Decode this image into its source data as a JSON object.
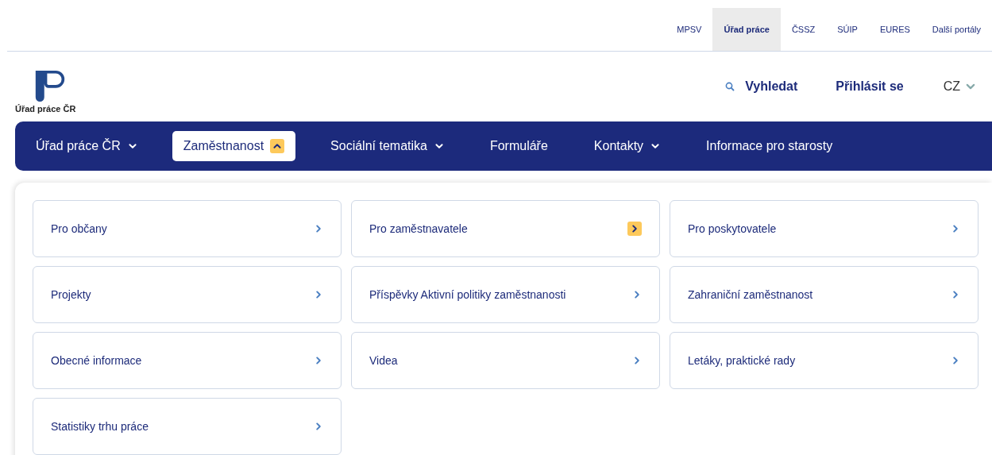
{
  "portal_links": [
    {
      "label": "MPSV",
      "selected": false
    },
    {
      "label": "Úřad práce",
      "selected": true
    },
    {
      "label": "ČSSZ",
      "selected": false
    },
    {
      "label": "SÚIP",
      "selected": false
    },
    {
      "label": "EURES",
      "selected": false
    },
    {
      "label": "Další portály",
      "selected": false
    }
  ],
  "logo": {
    "text": "Úřad práce ČR"
  },
  "header_actions": {
    "search": "Vyhledat",
    "login": "Přihlásit se",
    "language": "CZ"
  },
  "main_nav": [
    {
      "label": "Úřad práce ČR",
      "dropdown": true,
      "selected": false
    },
    {
      "label": "Zaměstnanost",
      "dropdown": true,
      "selected": true
    },
    {
      "label": "Sociální tematika",
      "dropdown": true,
      "selected": false
    },
    {
      "label": "Formuláře",
      "dropdown": false,
      "selected": false
    },
    {
      "label": "Kontakty",
      "dropdown": true,
      "selected": false
    },
    {
      "label": "Informace pro starosty",
      "dropdown": false,
      "selected": false
    }
  ],
  "submenu": [
    {
      "label": "Pro občany",
      "selected": false
    },
    {
      "label": "Pro zaměstnavatele",
      "selected": true
    },
    {
      "label": "Pro poskytovatele",
      "selected": false
    },
    {
      "label": "Projekty",
      "selected": false
    },
    {
      "label": "Příspěvky Aktivní politiky zaměstnanosti",
      "selected": false
    },
    {
      "label": "Zahraniční zaměstnanost",
      "selected": false
    },
    {
      "label": "Obecné informace",
      "selected": false
    },
    {
      "label": "Videa",
      "selected": false
    },
    {
      "label": "Letáky, praktické rady",
      "selected": false
    },
    {
      "label": "Statistiky trhu práce",
      "selected": false
    }
  ]
}
